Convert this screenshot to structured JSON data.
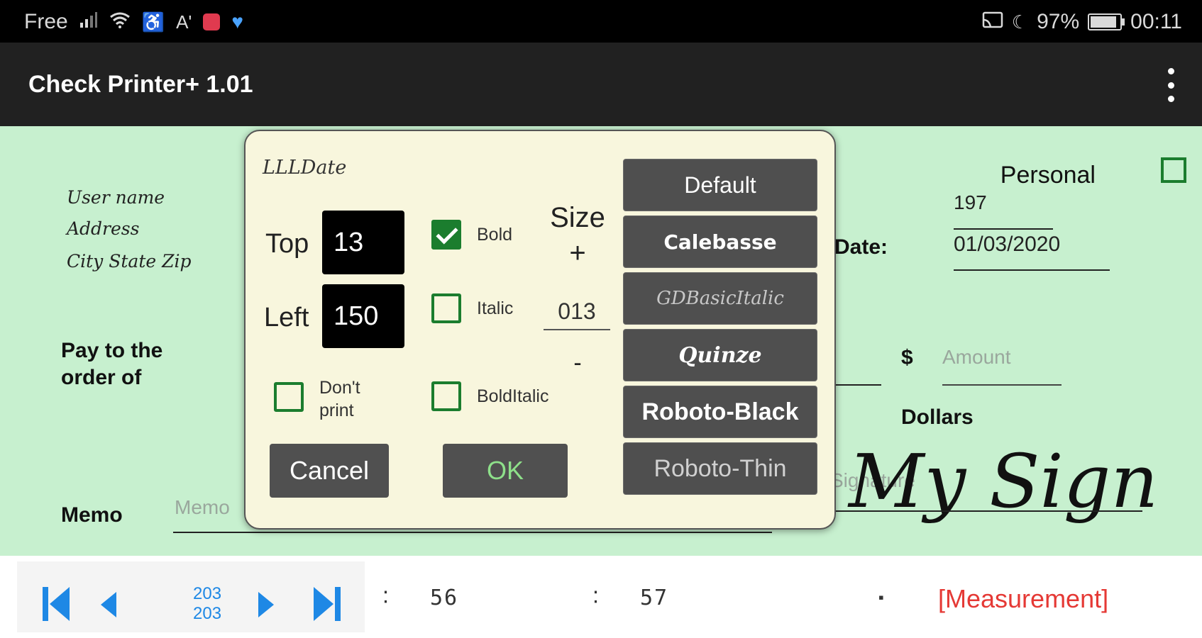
{
  "status": {
    "carrier": "Free",
    "battery": "97%",
    "time": "00:11"
  },
  "app": {
    "title": "Check Printer+ 1.01"
  },
  "check": {
    "user_name": "User name",
    "address": "Address",
    "city_state_zip": "City State Zip",
    "personal_label": "Personal",
    "check_number": "197",
    "date_label": "Date:",
    "date_value": "01/03/2020",
    "pay_to_line1": "Pay to the",
    "pay_to_line2": "order of",
    "dollar_sign": "$",
    "amount_placeholder": "Amount",
    "dollars_label": "Dollars",
    "memo_label": "Memo",
    "memo_placeholder": "Memo",
    "signature_placeholder": "Signature",
    "signature_value": "My Sign"
  },
  "dialog": {
    "field_name": "LLLDate",
    "top_label": "Top",
    "top_value": "13",
    "left_label": "Left",
    "left_value": "150",
    "bold_label": "Bold",
    "bold_checked": true,
    "italic_label": "Italic",
    "italic_checked": false,
    "bolditalic_label": "BoldItalic",
    "bolditalic_checked": false,
    "dont_print_line1": "Don't",
    "dont_print_line2": "print",
    "dont_print_checked": false,
    "size_label": "Size",
    "size_plus": "+",
    "size_value": "013",
    "size_minus": "-",
    "fonts": [
      "Default",
      "Calebasse",
      "GDBasicItalic",
      "Quinze",
      "Roboto-Black",
      "Roboto-Thin"
    ],
    "cancel_label": "Cancel",
    "ok_label": "OK",
    "ok_color": "#8ee08a"
  },
  "bottom": {
    "counter_current": "203",
    "counter_total": "203",
    "measure_a": "56",
    "measure_b": "57",
    "measurement_label": "[Measurement]",
    "measurement_color": "#e53935"
  }
}
